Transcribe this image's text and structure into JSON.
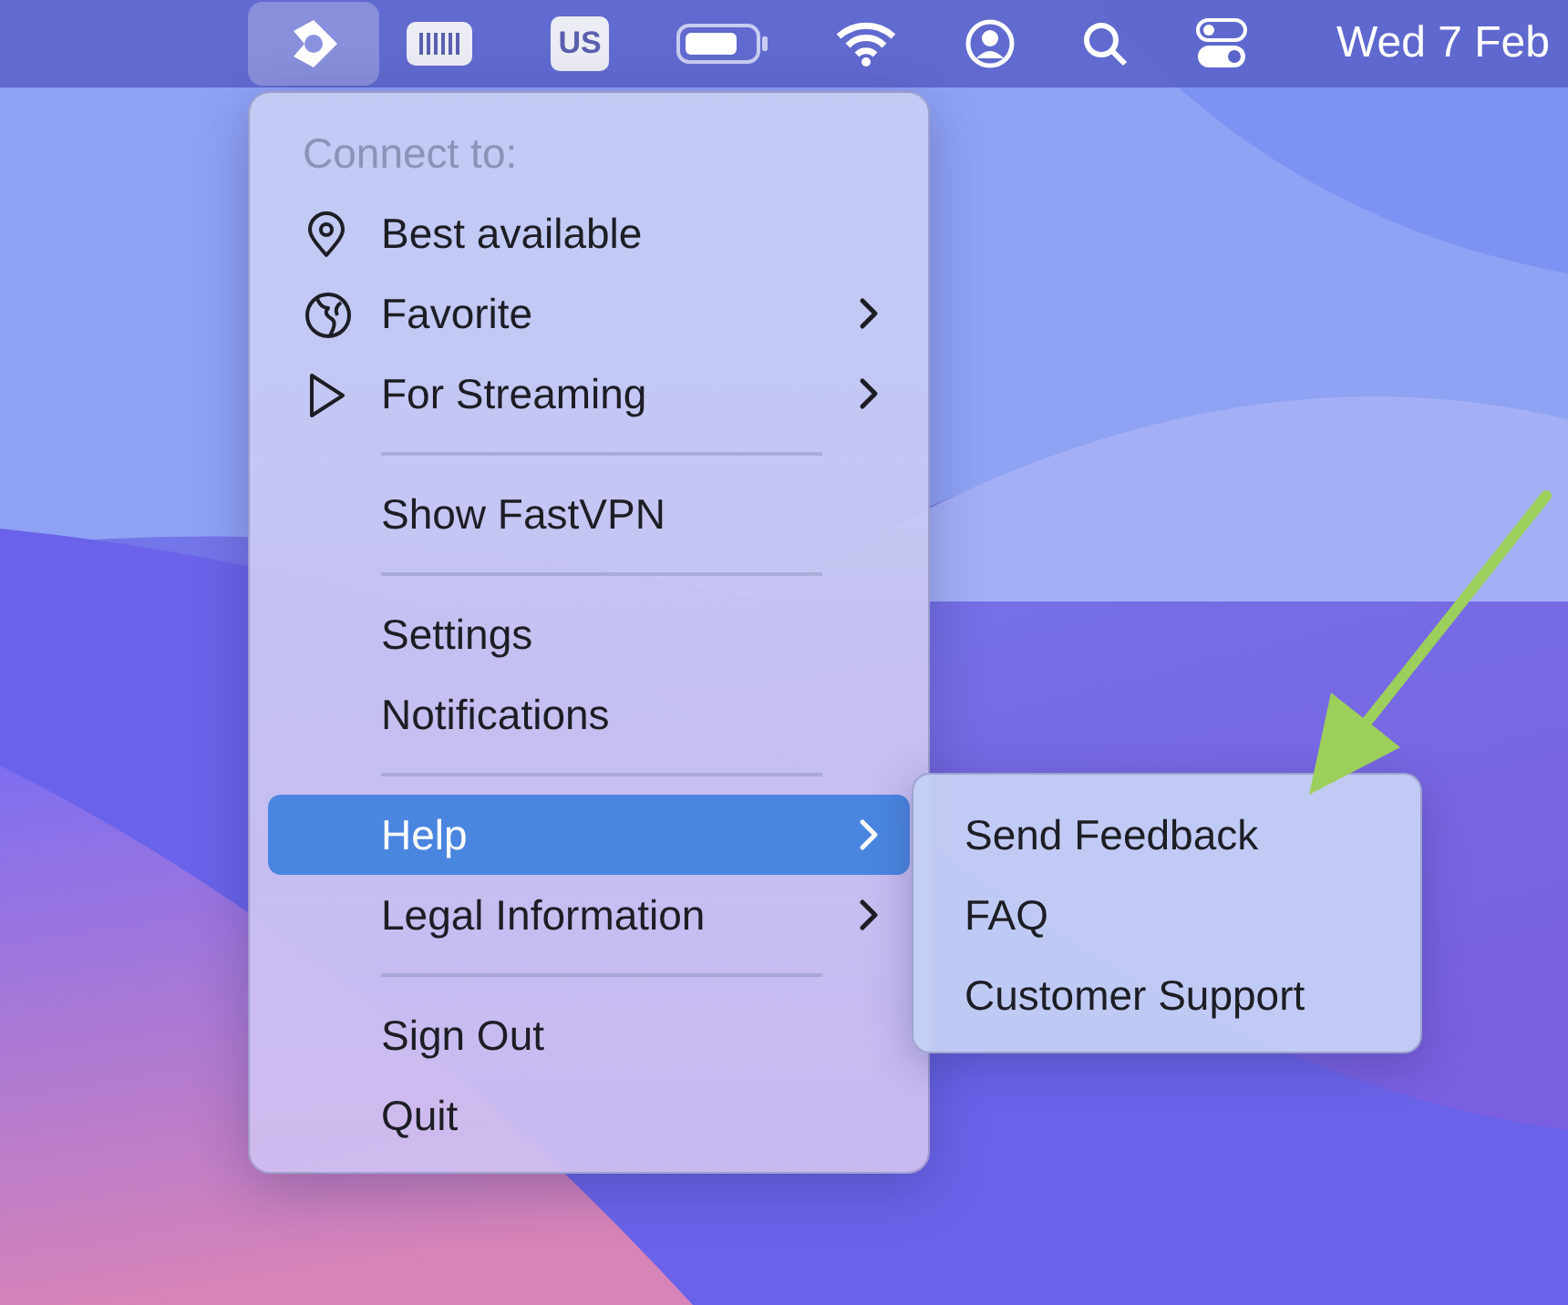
{
  "menu_bar": {
    "status_items": [
      {
        "kind": "app",
        "selected": true
      },
      {
        "kind": "keyboard",
        "selected": false
      },
      {
        "kind": "input",
        "label": "US",
        "selected": false
      },
      {
        "kind": "battery",
        "selected": false
      },
      {
        "kind": "wifi",
        "selected": false
      },
      {
        "kind": "user",
        "selected": false
      },
      {
        "kind": "search",
        "selected": false
      },
      {
        "kind": "controls",
        "selected": false
      }
    ],
    "clock": "Wed 7 Feb"
  },
  "menu": {
    "header": "Connect to:",
    "items": [
      {
        "kind": "pin",
        "label": "Best available",
        "submenu": false,
        "selected": false
      },
      {
        "kind": "globe",
        "label": "Favorite",
        "submenu": true,
        "selected": false
      },
      {
        "kind": "play",
        "label": "For Streaming",
        "submenu": true,
        "selected": false
      },
      {
        "kind": "separator"
      },
      {
        "kind": "item",
        "label": "Show FastVPN",
        "submenu": false,
        "selected": false
      },
      {
        "kind": "separator"
      },
      {
        "kind": "item",
        "label": "Settings",
        "submenu": false,
        "selected": false
      },
      {
        "kind": "item",
        "label": "Notifications",
        "submenu": false,
        "selected": false
      },
      {
        "kind": "separator"
      },
      {
        "kind": "item",
        "label": "Help",
        "submenu": true,
        "selected": true
      },
      {
        "kind": "item",
        "label": "Legal Information",
        "submenu": true,
        "selected": false
      },
      {
        "kind": "separator"
      },
      {
        "kind": "item",
        "label": "Sign Out",
        "submenu": false,
        "selected": false
      },
      {
        "kind": "item",
        "label": "Quit",
        "submenu": false,
        "selected": false
      }
    ]
  },
  "submenu": {
    "items": [
      {
        "label": "Send Feedback"
      },
      {
        "label": "FAQ"
      },
      {
        "label": "Customer Support"
      }
    ]
  },
  "annotation": {
    "kind": "arrow"
  }
}
